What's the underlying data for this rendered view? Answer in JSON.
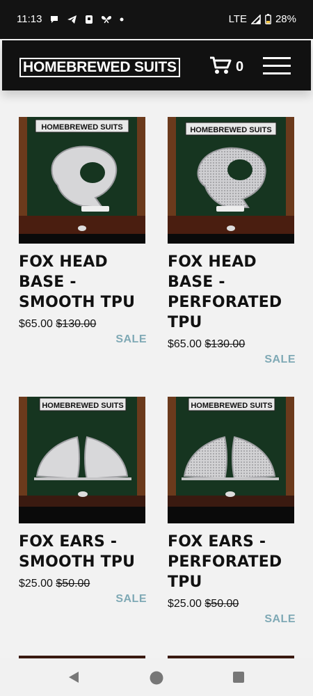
{
  "status_bar": {
    "time": "11:13",
    "network": "LTE",
    "battery": "28%"
  },
  "header": {
    "logo_text": "HOMEBREWED SUITS",
    "cart_count": "0"
  },
  "photo_sign": "HOMEBREWED SUITS",
  "products": [
    {
      "title": "FOX HEAD BASE - SMOOTH TPU",
      "price": "$65.00",
      "original_price": "$130.00",
      "badge": "SALE",
      "image": "head-smooth"
    },
    {
      "title": "FOX HEAD BASE - PERFORATED TPU",
      "price": "$65.00",
      "original_price": "$130.00",
      "badge": "SALE",
      "image": "head-perforated"
    },
    {
      "title": "FOX EARS - SMOOTH TPU",
      "price": "$25.00",
      "original_price": "$50.00",
      "badge": "SALE",
      "image": "ears-smooth"
    },
    {
      "title": "FOX EARS - PERFORATED TPU",
      "price": "$25.00",
      "original_price": "$50.00",
      "badge": "SALE",
      "image": "ears-perforated"
    }
  ],
  "colors": {
    "header_bg": "#111111",
    "sale": "#7fa9b5",
    "page_bg": "#f2f2f2"
  }
}
